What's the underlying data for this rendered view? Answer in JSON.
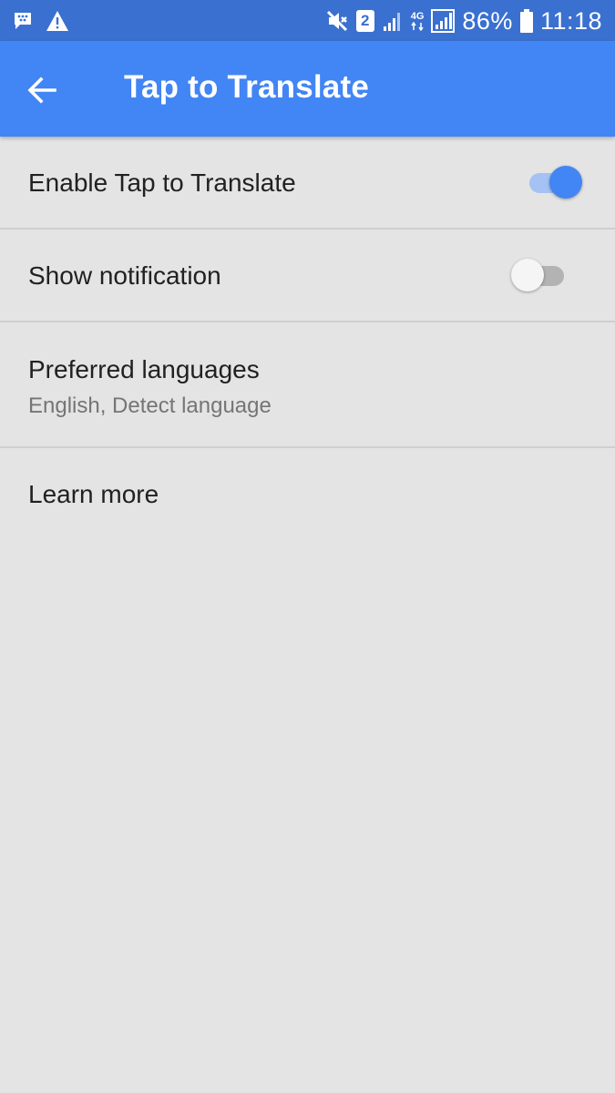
{
  "status_bar": {
    "left_icons": [
      "bbm-icon",
      "warning-icon"
    ],
    "right_icons": [
      "mute-icon",
      "sim-2-icon",
      "signal-icon",
      "4g-icon",
      "signal-full-icon",
      "battery-icon"
    ],
    "sim_label": "2",
    "network_label": "4G",
    "battery_percent": "86%",
    "time": "11:18"
  },
  "app_bar": {
    "title": "Tap to Translate",
    "back_icon": "arrow-back-icon",
    "color": "#4285f4"
  },
  "settings": [
    {
      "title": "Enable Tap to Translate",
      "toggle_on": true
    },
    {
      "title": "Show notification",
      "toggle_on": false
    },
    {
      "title": "Preferred languages",
      "summary": "English, Detect language"
    },
    {
      "title": "Learn more"
    }
  ],
  "colors": {
    "status_bar": "#3a70d0",
    "accent": "#4285f4",
    "background": "#e4e4e4"
  }
}
